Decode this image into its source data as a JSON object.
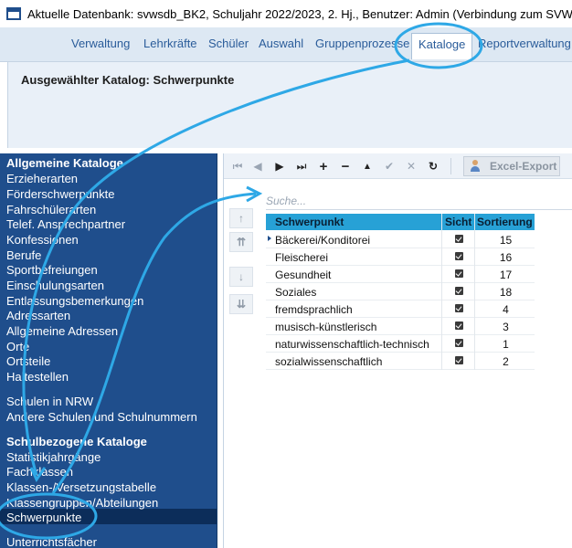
{
  "window": {
    "title": "Aktuelle Datenbank: svwsdb_BK2, Schuljahr 2022/2023, 2. Hj., Benutzer: Admin (Verbindung zum SVWS-Server vo"
  },
  "menu": {
    "items": [
      "Verwaltung",
      "Lehrkräfte",
      "Schüler",
      "Auswahl",
      "Gruppenprozesse",
      "Kataloge",
      "Reportverwaltung"
    ],
    "active": "Kataloge"
  },
  "info": {
    "title": "Ausgewählter Katalog: Schwerpunkte"
  },
  "nav": {
    "group1_title": "Allgemeine Kataloge",
    "group1_items": [
      "Erzieherarten",
      "Förderschwerpunkte",
      "Fahrschülerarten",
      "Telef. Ansprechpartner",
      "Konfessionen",
      "Berufe",
      "Sportbefreiungen",
      "Einschulungsarten",
      "Entlassungsbemerkungen",
      "Adressarten",
      "Allgemeine Adressen",
      "Orte",
      "Ortsteile",
      "Haltestellen"
    ],
    "group2_items": [
      "Schulen in NRW",
      "Andere Schulen und Schulnummern"
    ],
    "group3_title": "Schulbezogene Kataloge",
    "group3_items": [
      "Statistikjahrgänge",
      "Fachklassen",
      "Klassen-/Versetzungstabelle",
      "Klassengruppen/Abteilungen",
      "Schwerpunkte",
      "Unterrichtsfächer"
    ],
    "selected": "Schwerpunkte"
  },
  "toolbar": {
    "buttons": [
      "first-icon",
      "prev-icon",
      "next-icon",
      "last-icon",
      "add-icon",
      "remove-icon",
      "move-up-icon",
      "confirm-icon",
      "cancel-icon",
      "refresh-icon"
    ],
    "glyphs": [
      "⏮",
      "◀",
      "▶",
      "⏭",
      "+",
      "−",
      "▲",
      "✔",
      "✕",
      "↻"
    ],
    "export_label": "Excel-Export"
  },
  "side_buttons": {
    "glyphs": [
      "↑",
      "⇈",
      "↓",
      "⇊"
    ]
  },
  "search": {
    "placeholder": "Suche..."
  },
  "table": {
    "columns": [
      "Schwerpunkt",
      "Sichtb",
      "Sortierung"
    ],
    "rows": [
      {
        "name": "Bäckerei/Konditorei",
        "visible": true,
        "sort": "15"
      },
      {
        "name": "Fleischerei",
        "visible": true,
        "sort": "16"
      },
      {
        "name": "Gesundheit",
        "visible": true,
        "sort": "17"
      },
      {
        "name": "Soziales",
        "visible": true,
        "sort": "18"
      },
      {
        "name": "fremdsprachlich",
        "visible": true,
        "sort": "4"
      },
      {
        "name": "musisch-künstlerisch",
        "visible": true,
        "sort": "3"
      },
      {
        "name": "naturwissenschaftlich-technisch",
        "visible": true,
        "sort": "1"
      },
      {
        "name": "sozialwissenschaftlich",
        "visible": true,
        "sort": "2"
      }
    ]
  },
  "colors": {
    "nav_background": "#1f4e8c",
    "table_header": "#27a1d6",
    "annotation": "#2ea8e6"
  }
}
